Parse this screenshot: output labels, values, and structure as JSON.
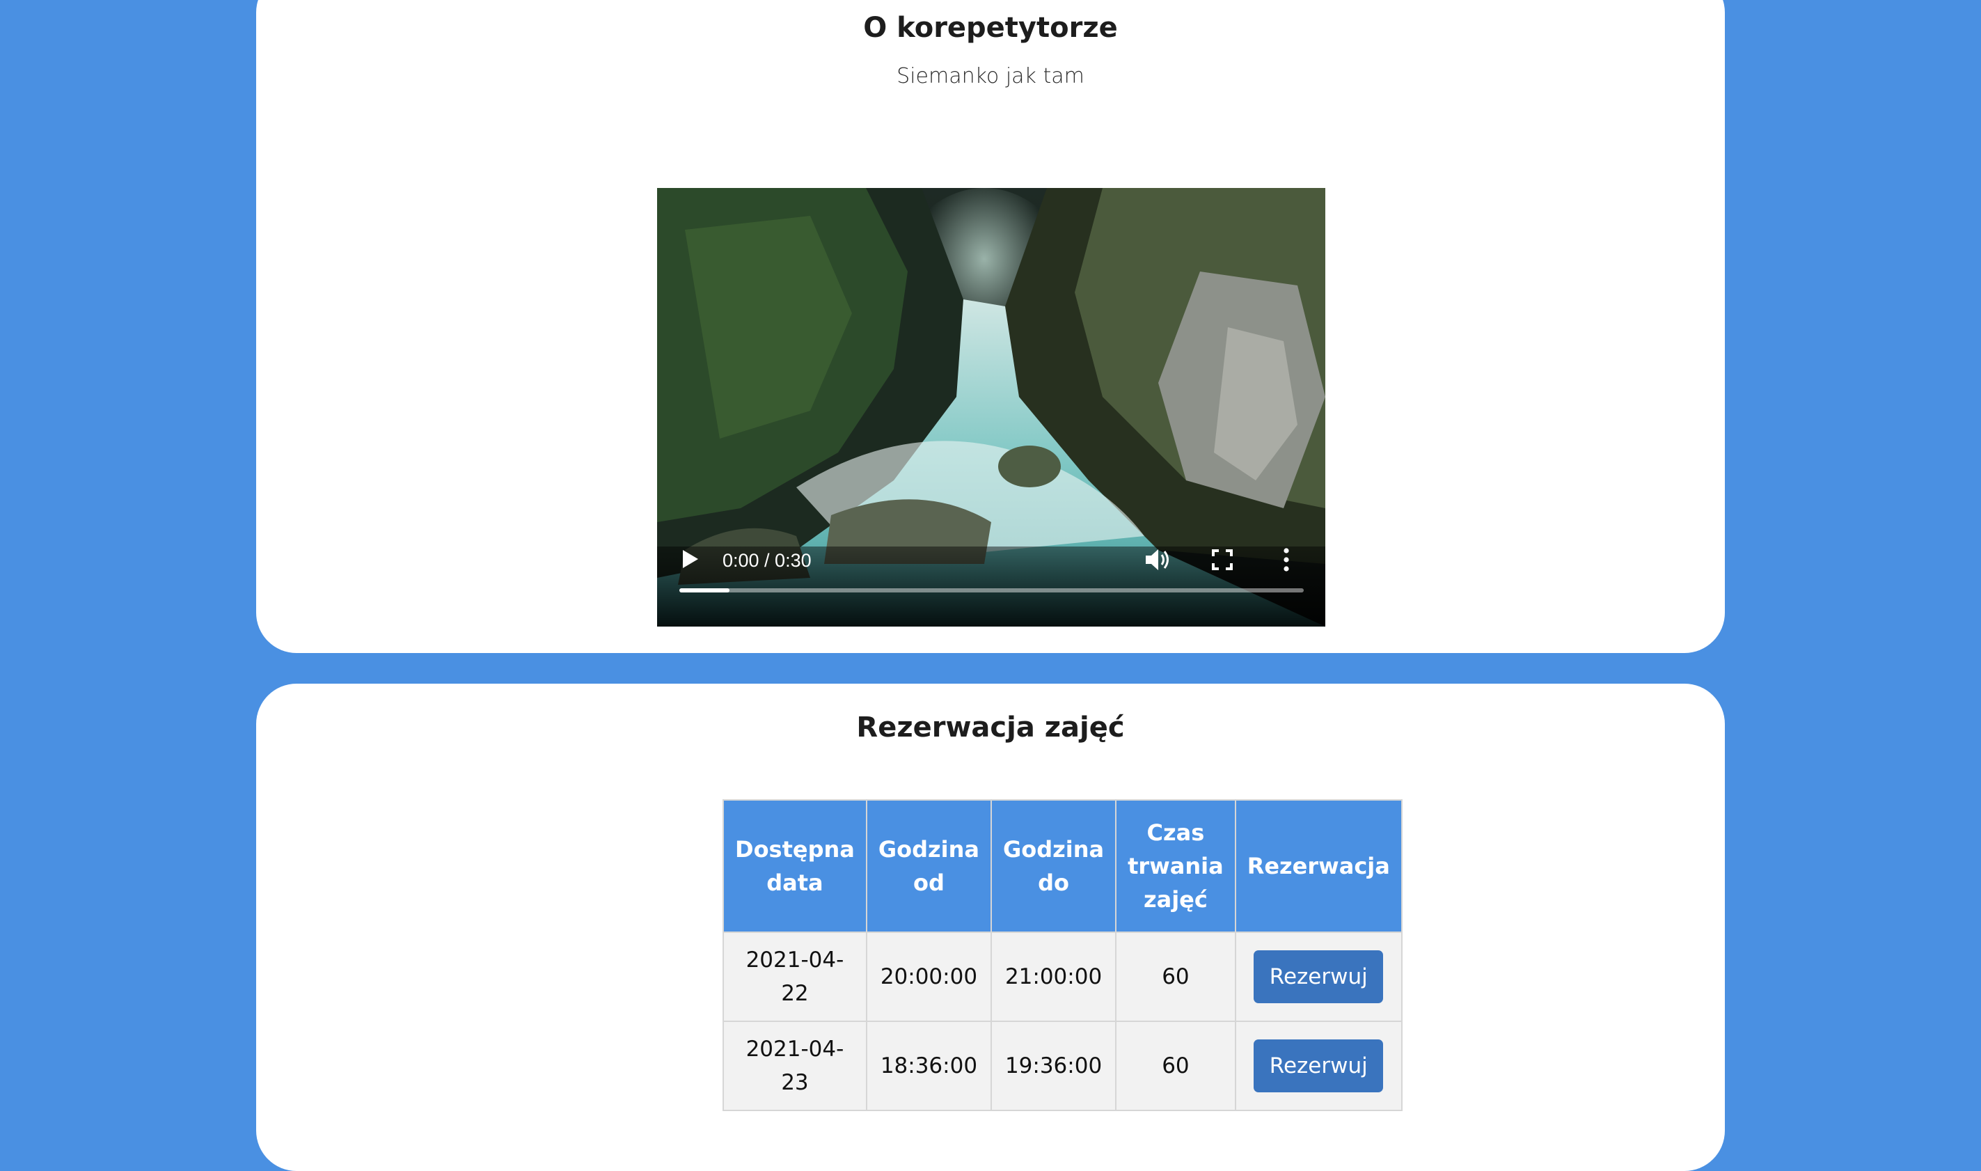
{
  "about": {
    "title": "O korepetytorze",
    "description": "Siemanko jak tam",
    "video": {
      "time_display": "0:00 / 0:30",
      "buffered_fraction": 0.08
    }
  },
  "booking": {
    "title": "Rezerwacja zajęć",
    "headers": [
      "Dostępna data",
      "Godzina od",
      "Godzina do",
      "Czas trwania zajęć",
      "Rezerwacja"
    ],
    "header_lines": [
      [
        "Dostępna",
        "data"
      ],
      [
        "Godzina",
        "od"
      ],
      [
        "Godzina",
        "do"
      ],
      [
        "Czas",
        "trwania",
        "zajęć"
      ],
      [
        "Rezerwacja"
      ]
    ],
    "rows": [
      {
        "date": "2021-04-22",
        "date_lines": [
          "2021-04-",
          "22"
        ],
        "from": "20:00:00",
        "to": "21:00:00",
        "duration": "60",
        "button": "Rezerwuj"
      },
      {
        "date": "2021-04-23",
        "date_lines": [
          "2021-04-",
          "23"
        ],
        "from": "18:36:00",
        "to": "19:36:00",
        "duration": "60",
        "button": "Rezerwuj"
      }
    ]
  },
  "colors": {
    "background": "#4a90e2",
    "card": "#ffffff",
    "table_header": "#4a90e2",
    "button": "#3a74be"
  },
  "icons": [
    "play-icon",
    "volume-icon",
    "fullscreen-icon",
    "more-options-icon"
  ]
}
